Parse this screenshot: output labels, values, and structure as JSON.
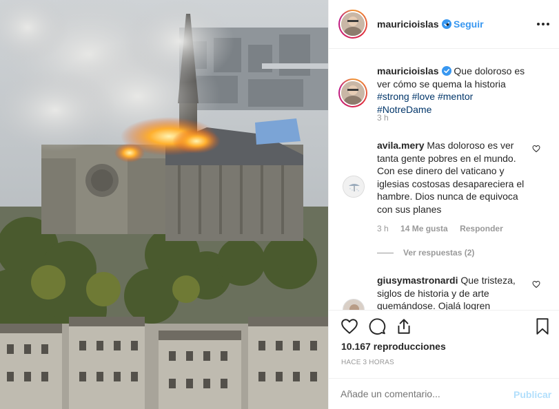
{
  "post": {
    "username": "mauricioislas",
    "dot": "•",
    "follow_label": "Seguir",
    "caption_prefix": "Que doloroso es ver cómo se quema la historia ",
    "hashtags": [
      "#strong",
      "#love",
      "#mentor",
      "#NotreDame"
    ],
    "caption_time": "3 h"
  },
  "comments": [
    {
      "username": "avila.mery",
      "text": "Mas doloroso es ver tanta gente pobres en el mundo. Con ese dinero del vaticano y iglesias costosas desapareciera el hambre. Dios nunca de equivoca con sus planes",
      "time": "3 h",
      "likes": "14 Me gusta",
      "reply_label": "Responder",
      "view_replies": "Ver respuestas (2)"
    },
    {
      "username": "giusymastronardi",
      "text": "Que tristeza, siglos de historia y de arte quemándose. Ojalá logren"
    }
  ],
  "actions": {
    "views": "10.167 reproducciones",
    "posted_ago": "HACE 3 HORAS"
  },
  "add_comment": {
    "placeholder": "Añade un comentario...",
    "publish_label": "Publicar"
  },
  "icons": {
    "verified": "verified-badge-icon",
    "more": "more-options-icon",
    "like": "heart-icon",
    "comment": "comment-bubble-icon",
    "share": "share-upload-icon",
    "save": "bookmark-icon"
  },
  "colors": {
    "link": "#3897f0",
    "hashtag": "#003569",
    "muted": "#999999",
    "publish_disabled": "#b2dffc"
  }
}
